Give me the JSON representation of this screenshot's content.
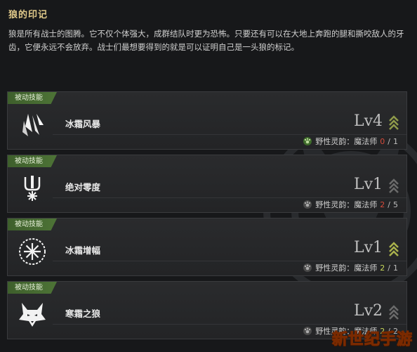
{
  "header": {
    "title": "狼的印记",
    "description": "狼是所有战士的图腾。它不仅个体强大，成群结队时更为恐怖。只要还有可以在大地上奔跑的腿和撕咬敌人的牙齿，它便永远不会放弃。战士们最想要得到的就是可以证明自己是一头狼的标记。"
  },
  "skills": [
    {
      "tag": "被动技能",
      "name": "冰霜风暴",
      "level": "Lv4",
      "trait": "野性灵韵：魔法师",
      "count_current": "0",
      "count_sep": "/",
      "count_max": "1",
      "icon": "crystal-shards-icon",
      "met": false
    },
    {
      "tag": "被动技能",
      "name": "绝对零度",
      "level": "Lv1",
      "trait": "野性灵韵：魔法师",
      "count_current": "2",
      "count_sep": "/",
      "count_max": "5",
      "icon": "frost-pillar-icon",
      "met": false
    },
    {
      "tag": "被动技能",
      "name": "冰霜增幅",
      "level": "Lv1",
      "trait": "野性灵韵：魔法师",
      "count_current": "2",
      "count_sep": "/",
      "count_max": "1",
      "icon": "snowflake-ring-icon",
      "met": true
    },
    {
      "tag": "被动技能",
      "name": "寒霜之狼",
      "level": "Lv2",
      "trait": "野性灵韵：魔法师",
      "count_current": "2",
      "count_sep": "/",
      "count_max": "2",
      "icon": "wolf-head-icon",
      "met": true
    }
  ],
  "watermark": "新世纪手游",
  "colors": {
    "tag_green": "#4d7336",
    "title_gold": "#e0c98a",
    "count_red": "#d64a3a",
    "count_green": "#c8d95a"
  }
}
